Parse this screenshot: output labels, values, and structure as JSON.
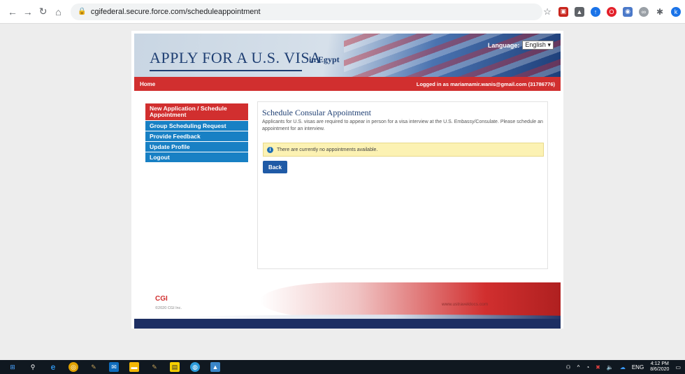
{
  "browser": {
    "url": "cgifederal.secure.force.com/scheduleappointment",
    "extension_icons": [
      "star-icon",
      "pdf-icon",
      "drive-icon",
      "arrow-up-icon",
      "opera-icon",
      "camera-icon",
      "link-icon",
      "puzzle-icon",
      "profile-icon"
    ],
    "profile_initial": "k"
  },
  "banner": {
    "title": "APPLY FOR A U.S. VISA",
    "country": "in Egypt",
    "language_label": "Language:",
    "language_value": "English"
  },
  "topbar": {
    "home": "Home",
    "login_status": "Logged in as  mariamamir.wanis@gmail.com (31786776)"
  },
  "menu": {
    "items": [
      {
        "label": "New Application / Schedule Appointment",
        "active": true
      },
      {
        "label": "Group Scheduling Request",
        "active": false
      },
      {
        "label": "Provide Feedback",
        "active": false
      },
      {
        "label": "Update Profile",
        "active": false
      },
      {
        "label": "Logout",
        "active": false
      }
    ]
  },
  "main": {
    "heading": "Schedule Consular Appointment",
    "description": "Applicants for U.S. visas are required to appear in person for a visa interview at the U.S. Embassy/Consulate. Please schedule an appointment for an interview.",
    "alert": "There are currently no appointments available.",
    "back_button": "Back"
  },
  "footer": {
    "brand": "CGI",
    "copyright": "©2020 CGI Inc.",
    "site": "www.ustraveldocs.com"
  },
  "taskbar": {
    "lang": "ENG",
    "time": "4:12 PM",
    "date": "8/6/2020"
  },
  "colors": {
    "accent_red": "#d12f2f",
    "menu_blue": "#1880c4",
    "navy": "#1f3f73",
    "alert_yellow": "#fcf2b3"
  }
}
